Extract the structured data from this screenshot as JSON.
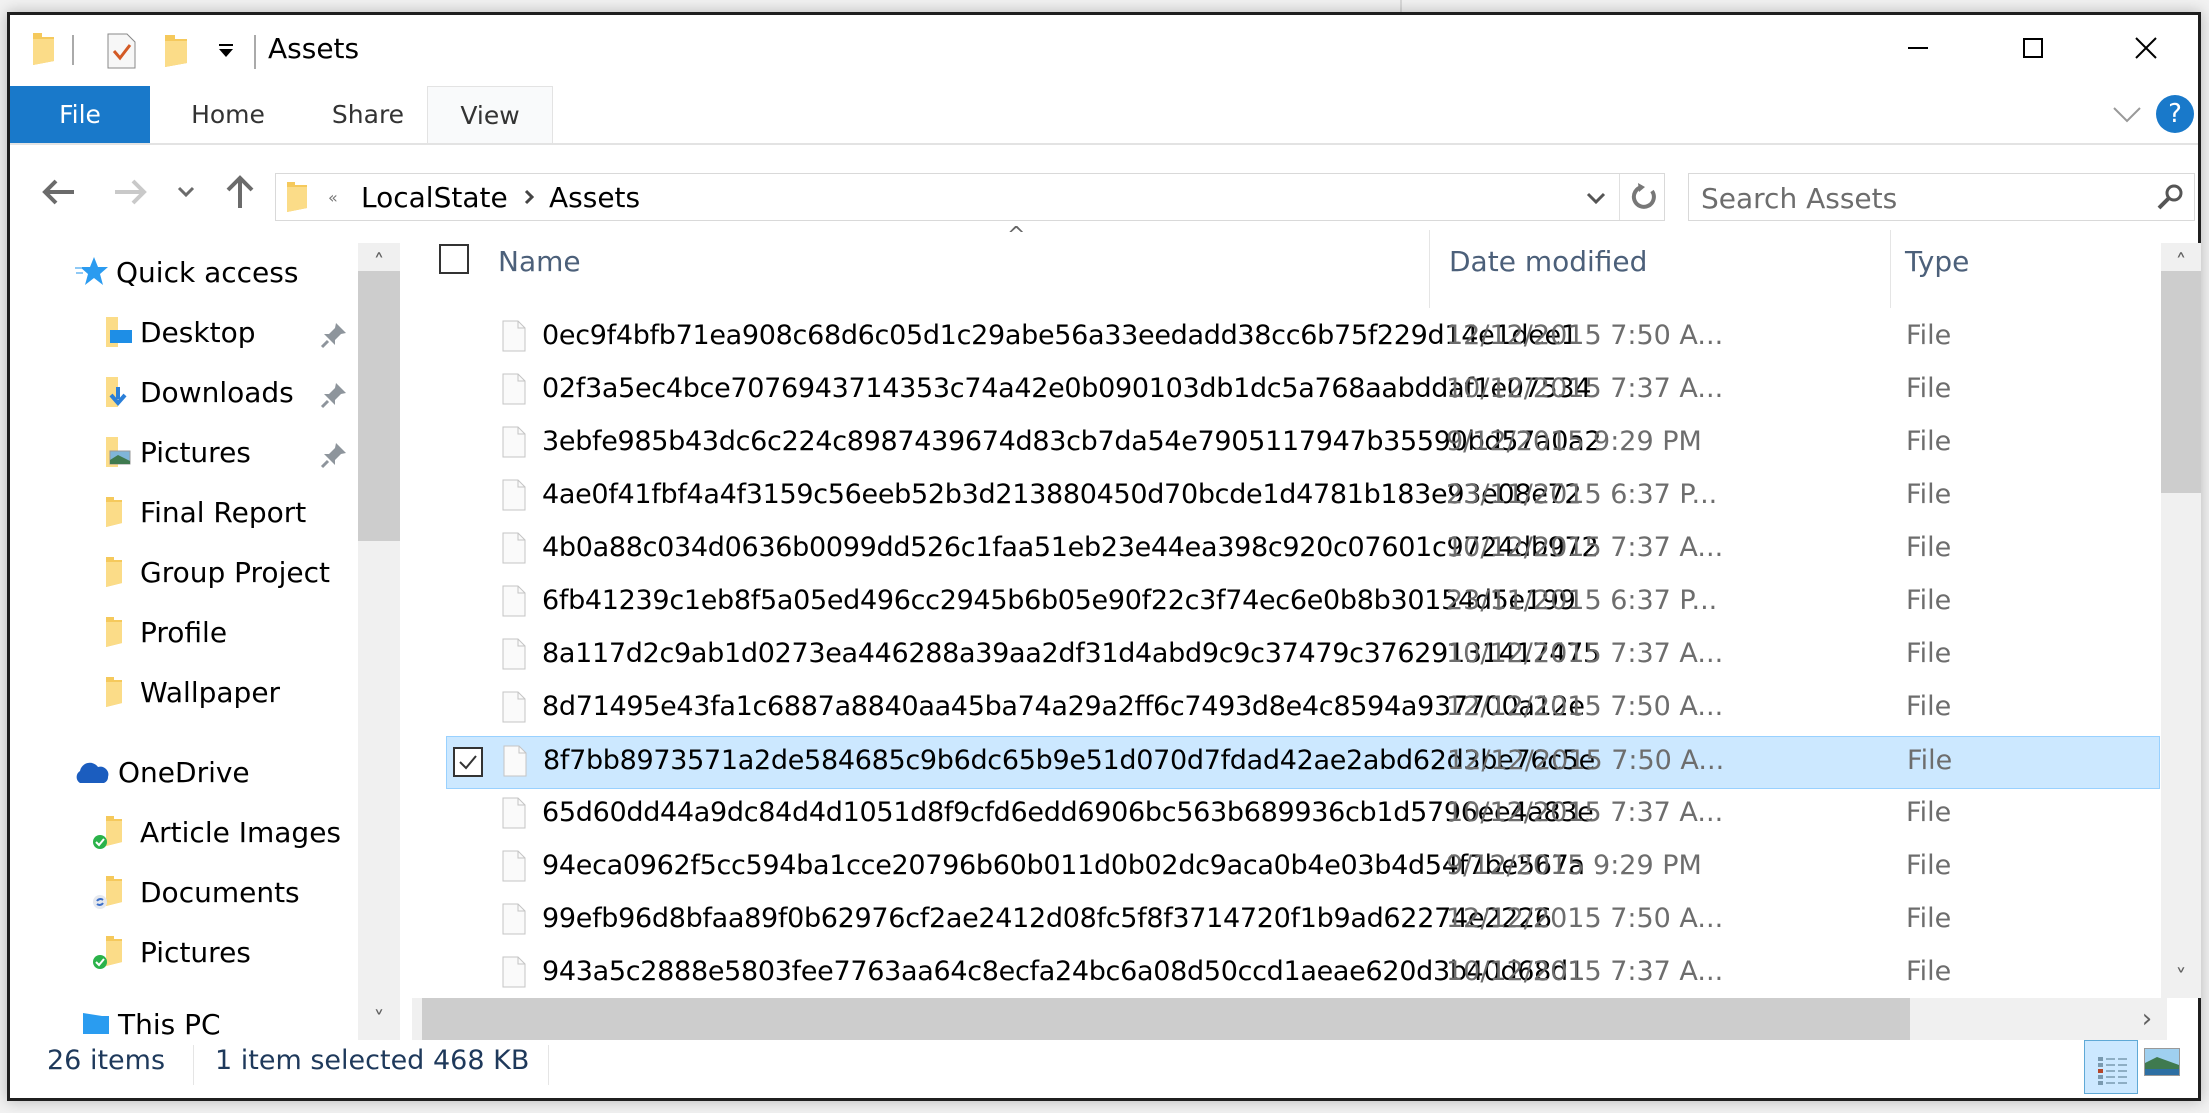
{
  "window": {
    "title": "Assets",
    "controls": {
      "minimize": "minimize",
      "maximize": "maximize",
      "close": "close"
    }
  },
  "quick_access_toolbar": {
    "items": [
      "folder-icon",
      "properties-icon",
      "new-folder-icon",
      "customize-dropdown-icon"
    ]
  },
  "ribbon": {
    "tabs": [
      {
        "label": "File",
        "active": true
      },
      {
        "label": "Home"
      },
      {
        "label": "Share"
      },
      {
        "label": "View"
      }
    ],
    "help": "?",
    "accent": "#1979ca"
  },
  "address_bar": {
    "overflow": "«",
    "crumbs": [
      "LocalState",
      "Assets"
    ],
    "search_placeholder": "Search Assets"
  },
  "nav_pane": {
    "quick_access_label": "Quick access",
    "quick_access": [
      {
        "label": "Desktop",
        "pinned": true,
        "icon": "desktop-folder-icon"
      },
      {
        "label": "Downloads",
        "pinned": true,
        "icon": "downloads-folder-icon"
      },
      {
        "label": "Pictures",
        "pinned": true,
        "icon": "pictures-folder-icon"
      },
      {
        "label": "Final Report",
        "pinned": false,
        "icon": "folder-icon"
      },
      {
        "label": "Group Project",
        "pinned": false,
        "icon": "folder-icon"
      },
      {
        "label": "Profile",
        "pinned": false,
        "icon": "folder-icon"
      },
      {
        "label": "Wallpaper",
        "pinned": false,
        "icon": "folder-icon"
      }
    ],
    "onedrive_label": "OneDrive",
    "onedrive": [
      {
        "label": "Article Images",
        "status": "synced"
      },
      {
        "label": "Documents",
        "status": "syncing"
      },
      {
        "label": "Pictures",
        "status": "synced"
      }
    ],
    "this_pc_label": "This PC"
  },
  "file_list": {
    "columns": {
      "name": "Name",
      "date": "Date modified",
      "type": "Type"
    },
    "sort_indicator": "^",
    "rows": [
      {
        "name": "0ec9f4bfb71ea908c68d6c05d1c29abe56a33eedadd38cc6b75f229d14e1dee1",
        "date": "12/12/2015 7:50 A...",
        "type": "File",
        "selected": false
      },
      {
        "name": "02f3a5ec4bce7076943714353c74a42e0b090103db1dc5a768aabddaf1e07534",
        "date": "10/12/2015 7:37 A...",
        "type": "File",
        "selected": false
      },
      {
        "name": "3ebfe985b43dc6c224c8987439674d83cb7da54e7905117947b35590bd57a0a2",
        "date": "9/12/2015 9:29 PM",
        "type": "File",
        "selected": false
      },
      {
        "name": "4ae0f41fbf4a4f3159c56eeb52b3d213880450d70bcde1d4781b183e93e08e72",
        "date": "23/11/2015 6:37 P...",
        "type": "File",
        "selected": false
      },
      {
        "name": "4b0a88c034d0636b0099dd526c1faa51eb23e44ea398c920c07601c9724db972",
        "date": "10/12/2015 7:37 A...",
        "type": "File",
        "selected": false
      },
      {
        "name": "6fb41239c1eb8f5a05ed496cc2945b6b05e90f22c3f74ec6e0b8b30154d5e199",
        "date": "23/11/2015 6:37 P...",
        "type": "File",
        "selected": false
      },
      {
        "name": "8a117d2c9ab1d0273ea446288a39aa2df31d4abd9c9c37479c37629131417475",
        "date": "10/12/2015 7:37 A...",
        "type": "File",
        "selected": false
      },
      {
        "name": "8d71495e43fa1c6887a8840aa45ba74a29a2ff6c7493d8e4c8594a937700a12e",
        "date": "12/12/2015 7:50 A...",
        "type": "File",
        "selected": false
      },
      {
        "name": "8f7bb8973571a2de584685c9b6dc65b9e51d070d7fdad42ae2abd62d3be76c5e",
        "date": "12/12/2015 7:50 A...",
        "type": "File",
        "selected": true
      },
      {
        "name": "65d60dd44a9dc84d4d1051d8f9cfd6edd6906bc563b689936cb1d5796ee4a83e",
        "date": "10/12/2015 7:37 A...",
        "type": "File",
        "selected": false
      },
      {
        "name": "94eca0962f5cc594ba1cce20796b60b011d0b02dc9aca0b4e03b4d54f7be567a",
        "date": "9/12/2015 9:29 PM",
        "type": "File",
        "selected": false
      },
      {
        "name": "99efb96d8bfaa89f0b62976cf2ae2412d08fc5f8f3714720f1b9ad62274e2226",
        "date": "12/12/2015 7:50 A...",
        "type": "File",
        "selected": false
      },
      {
        "name": "943a5c2888e5803fee7763aa64c8ecfa24bc6a08d50ccd1aeae620d3b40d68d1",
        "date": "10/12/2015 7:37 A...",
        "type": "File",
        "selected": false
      }
    ],
    "selection_color": "#cce8ff"
  },
  "status_bar": {
    "item_count": "26 items",
    "selection": "1 item selected",
    "size": "468 KB",
    "views": [
      "details-view",
      "large-icons-view"
    ],
    "active_view": "details-view"
  }
}
